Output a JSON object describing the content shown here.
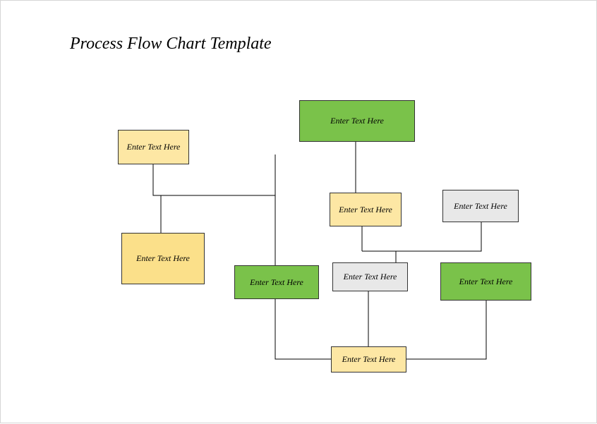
{
  "title": "Process Flow Chart Template",
  "placeholder": "Enter Text Here",
  "boxes": {
    "b1": {
      "label": "Enter Text Here"
    },
    "b2": {
      "label": "Enter Text Here"
    },
    "b3": {
      "label": "Enter Text Here"
    },
    "b4": {
      "label": "Enter Text Here"
    },
    "b5": {
      "label": "Enter Text Here"
    },
    "b6": {
      "label": "Enter Text Here"
    },
    "b7": {
      "label": "Enter Text Here"
    },
    "b8": {
      "label": "Enter Text Here"
    },
    "b9": {
      "label": "Enter Text Here"
    }
  },
  "colors": {
    "yellow": "#fde7a4",
    "yellow_dark": "#fbe08a",
    "green": "#7ac24a",
    "gray": "#e8e8e8"
  }
}
